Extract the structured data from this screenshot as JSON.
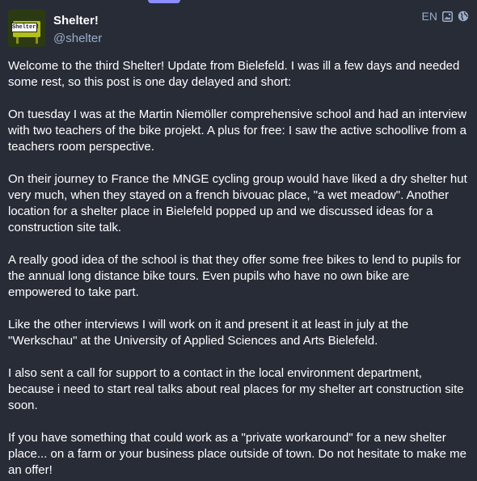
{
  "account": {
    "display_name": "Shelter!",
    "username": "@shelter",
    "avatar_text": "Shelter!"
  },
  "meta": {
    "language": "EN",
    "icons": [
      "image-icon",
      "globe-icon"
    ]
  },
  "content": {
    "paragraphs": [
      "Welcome to the third Shelter! Update from Bielefeld. I was ill a few days and needed some rest, so this post is one day delayed and short:",
      "On tuesday I was at the Martin Niemöller comprehensive school and had an interview with two teachers of the bike projekt. A plus for free: I saw the active schoollive from a teachers room perspective.",
      "On their journey to France the MNGE cycling group would have liked a dry shelter hut very much, when they stayed on a french bivouac place, \"a wet meadow\". Another location for a shelter place in Bielefeld popped up and we discussed ideas for a construction site talk.",
      "A really good idea of the school is that they offer some free bikes to lend to pupils for the annual long distance bike tours. Even pupils who have no own bike are empowered to take part.",
      "Like the other interviews I will work on it and present it at least in july at the \"Werkschau\" at the University of Applied Sciences and Arts Bielefeld.",
      "I also sent a call for support to a contact in the local environment department, because i need to start real talks about real places for my shelter art construction site soon.",
      "If you have something that could work as a \"private workaround\" for a new shelter place... on a farm or your business place outside of town. Do not hesitate to make me an offer!"
    ]
  },
  "colors": {
    "background": "#282c37",
    "text": "#ffffff",
    "secondary": "#9baec8",
    "accent": "#8c8dff"
  }
}
